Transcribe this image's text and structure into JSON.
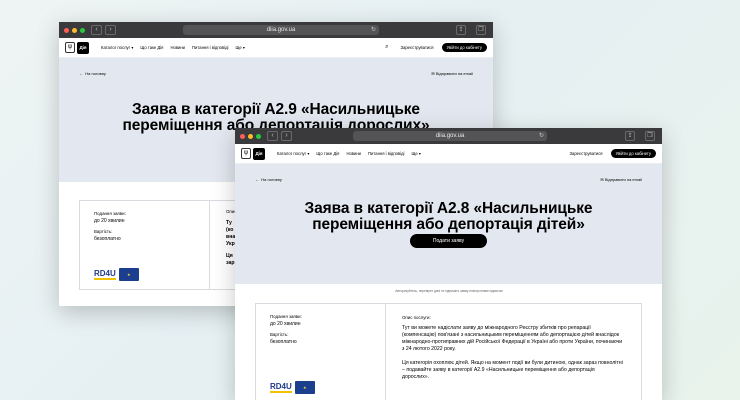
{
  "browser": {
    "url": "diia.gov.ua"
  },
  "header": {
    "catalog": "Каталог послуг",
    "what_is": "Що таке Дія",
    "news": "Новини",
    "faq": "Питання і відповіді",
    "more": "Ще",
    "register": "Зареєструватися",
    "login": "Увійти до кабінету",
    "logo_text": "Дія"
  },
  "common": {
    "back": "На головну",
    "share": "Відправити на email",
    "submission_label": "Подання заяви:",
    "submission_value": "до 20 хвилин",
    "cost_label": "Вартість:",
    "cost_value": "безоплатно",
    "desc_label": "Опис послуги:",
    "rd4u": "RD4U"
  },
  "window1": {
    "title_line1": "Заява в категорії А2.9 «Насильницьке",
    "title_line2": "переміщення або депортація дорослих»",
    "frag1": "Ту",
    "frag2": "(ко",
    "frag3": "вна",
    "frag4": "Укр",
    "frag5": "Ця",
    "frag6": "зар"
  },
  "window2": {
    "title_line1": "Заява в категорії А2.8 «Насильницьке",
    "title_line2": "переміщення або депортація дітей»",
    "submit": "Подати заяву",
    "hint": "Авторизуйтесь, перевірте дані та підпишіть заяву електронним підписом",
    "desc_p1": "Тут ви можете надіслати заяву до міжнародного Реєстру збитків про репарації (компенсацію) пов'язані з насильницьким переміщенням або депортацією дітей внаслідок міжнародно-протиправних дій Російської Федерації в Україні або проти України, починаючи з 24 лютого 2022 року.",
    "desc_p2": "Ця категорія охоплює дітей. Якщо на момент події ви були дитиною, однак зараз повнолітні – подавайте заяву в категорії А2.9 «Насильницьке переміщення або депортація дорослих»."
  }
}
